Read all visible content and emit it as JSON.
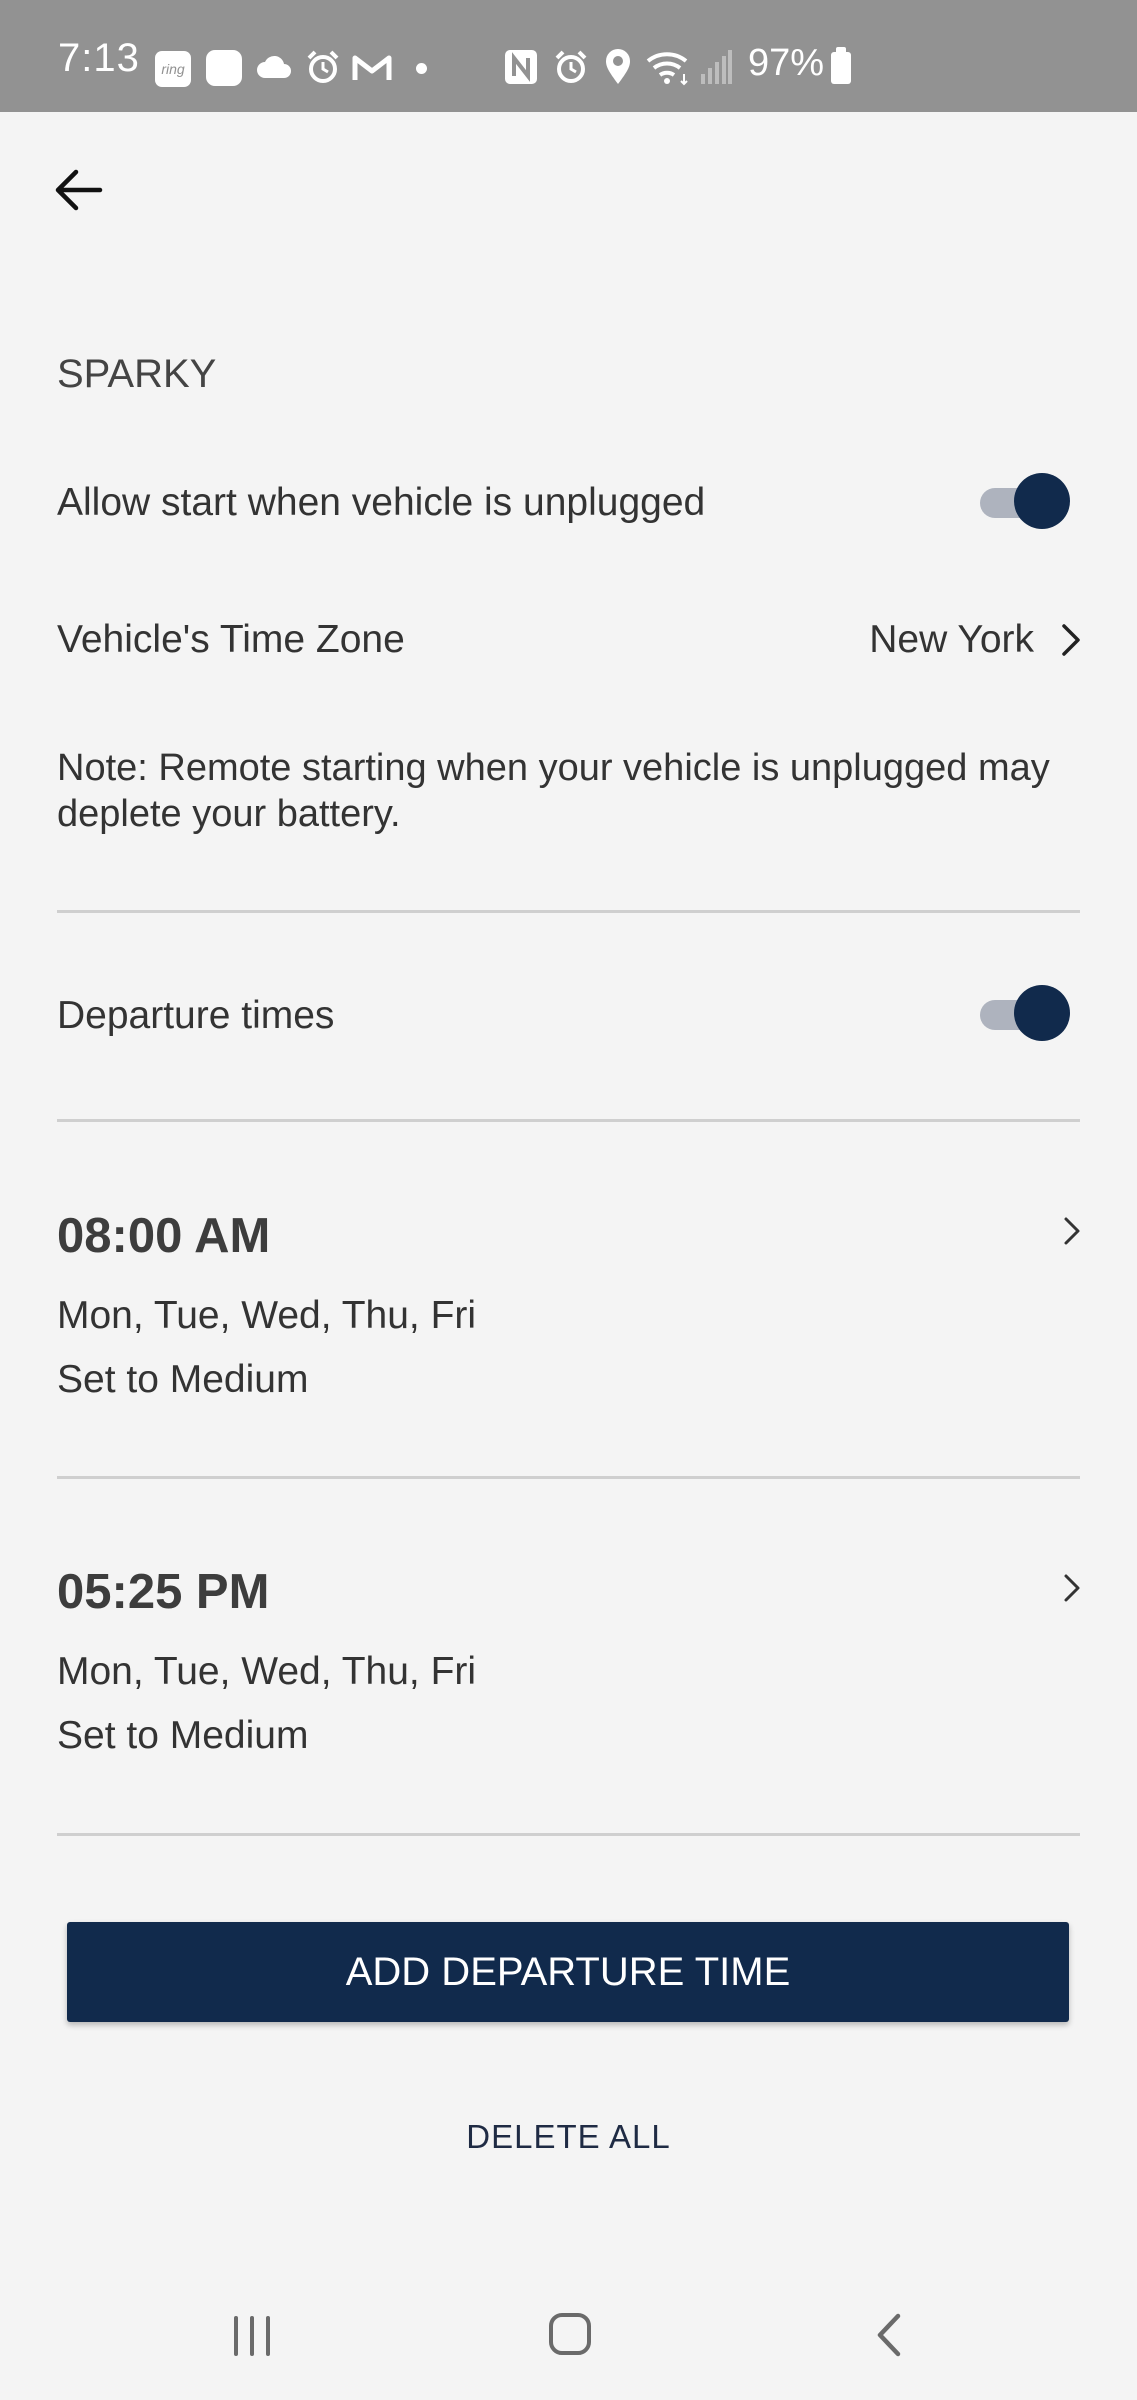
{
  "status_bar": {
    "time": "7:13",
    "ring_label": "ring",
    "battery_percent": "97%",
    "icons": [
      "ring-icon",
      "app-icon",
      "cloud-icon",
      "alarm-icon",
      "gmail-icon",
      "dot-icon",
      "nfc-icon",
      "alarm-icon",
      "location-icon",
      "wifi-icon",
      "signal-icon",
      "battery-icon"
    ]
  },
  "header": {
    "back_icon": "arrow-left-icon"
  },
  "vehicle": {
    "name": "SPARKY"
  },
  "settings": {
    "allow_unplugged_label": "Allow start when vehicle is unplugged",
    "allow_unplugged_on": true,
    "timezone_label": "Vehicle's Time Zone",
    "timezone_value": "New York",
    "note": "Note: Remote starting when your vehicle is unplugged may deplete your battery.",
    "departure_times_label": "Departure times",
    "departure_times_on": true
  },
  "departures": [
    {
      "time": "08:00 AM",
      "days": "Mon, Tue, Wed, Thu, Fri",
      "level": "Set to Medium"
    },
    {
      "time": "05:25 PM",
      "days": "Mon, Tue, Wed, Thu, Fri",
      "level": "Set to Medium"
    }
  ],
  "actions": {
    "add_label": "ADD DEPARTURE TIME",
    "delete_label": "DELETE ALL"
  },
  "colors": {
    "accent": "#112a4c",
    "toggle_track": "#aeb3be",
    "background": "#f4f4f4",
    "status_bar": "#929292"
  },
  "nav_bar": {
    "icons": [
      "recent-apps-icon",
      "home-icon",
      "back-icon"
    ]
  }
}
